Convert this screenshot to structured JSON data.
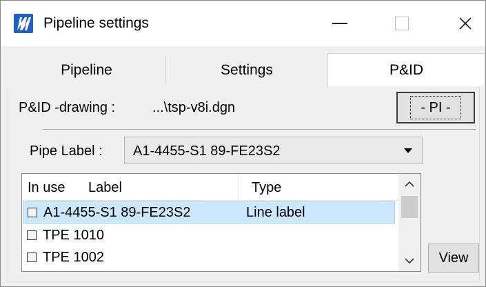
{
  "window": {
    "title": "Pipeline settings",
    "app_icon": "pipeline-logo-icon",
    "controls": {
      "minimize_icon": "minimize-icon",
      "maximize_icon": "maximize-icon",
      "close_icon": "close-icon"
    }
  },
  "tabs": [
    {
      "label": "Pipeline",
      "active": false
    },
    {
      "label": "Settings",
      "active": false
    },
    {
      "label": "P&ID",
      "active": true
    }
  ],
  "pid": {
    "drawing_label": "P&ID -drawing :",
    "drawing_value": "...\\tsp-v8i.dgn",
    "pi_button": "- PI -"
  },
  "pipe_label": {
    "label": "Pipe Label :",
    "selected": "A1-4455-S1 89-FE23S2"
  },
  "list": {
    "headers": {
      "in_use": "In use",
      "label": "Label",
      "type": "Type"
    },
    "rows": [
      {
        "checked": false,
        "label": "A1-4455-S1 89-FE23S2",
        "type": "Line label",
        "selected": true
      },
      {
        "checked": false,
        "label": "TPE 1010",
        "type": "",
        "selected": false
      },
      {
        "checked": false,
        "label": "TPE 1002",
        "type": "",
        "selected": false
      }
    ]
  },
  "view_button": "View",
  "colors": {
    "accent": "#1f5fc8",
    "selection": "#cce8ff",
    "window_bg": "#f0f0f0"
  }
}
